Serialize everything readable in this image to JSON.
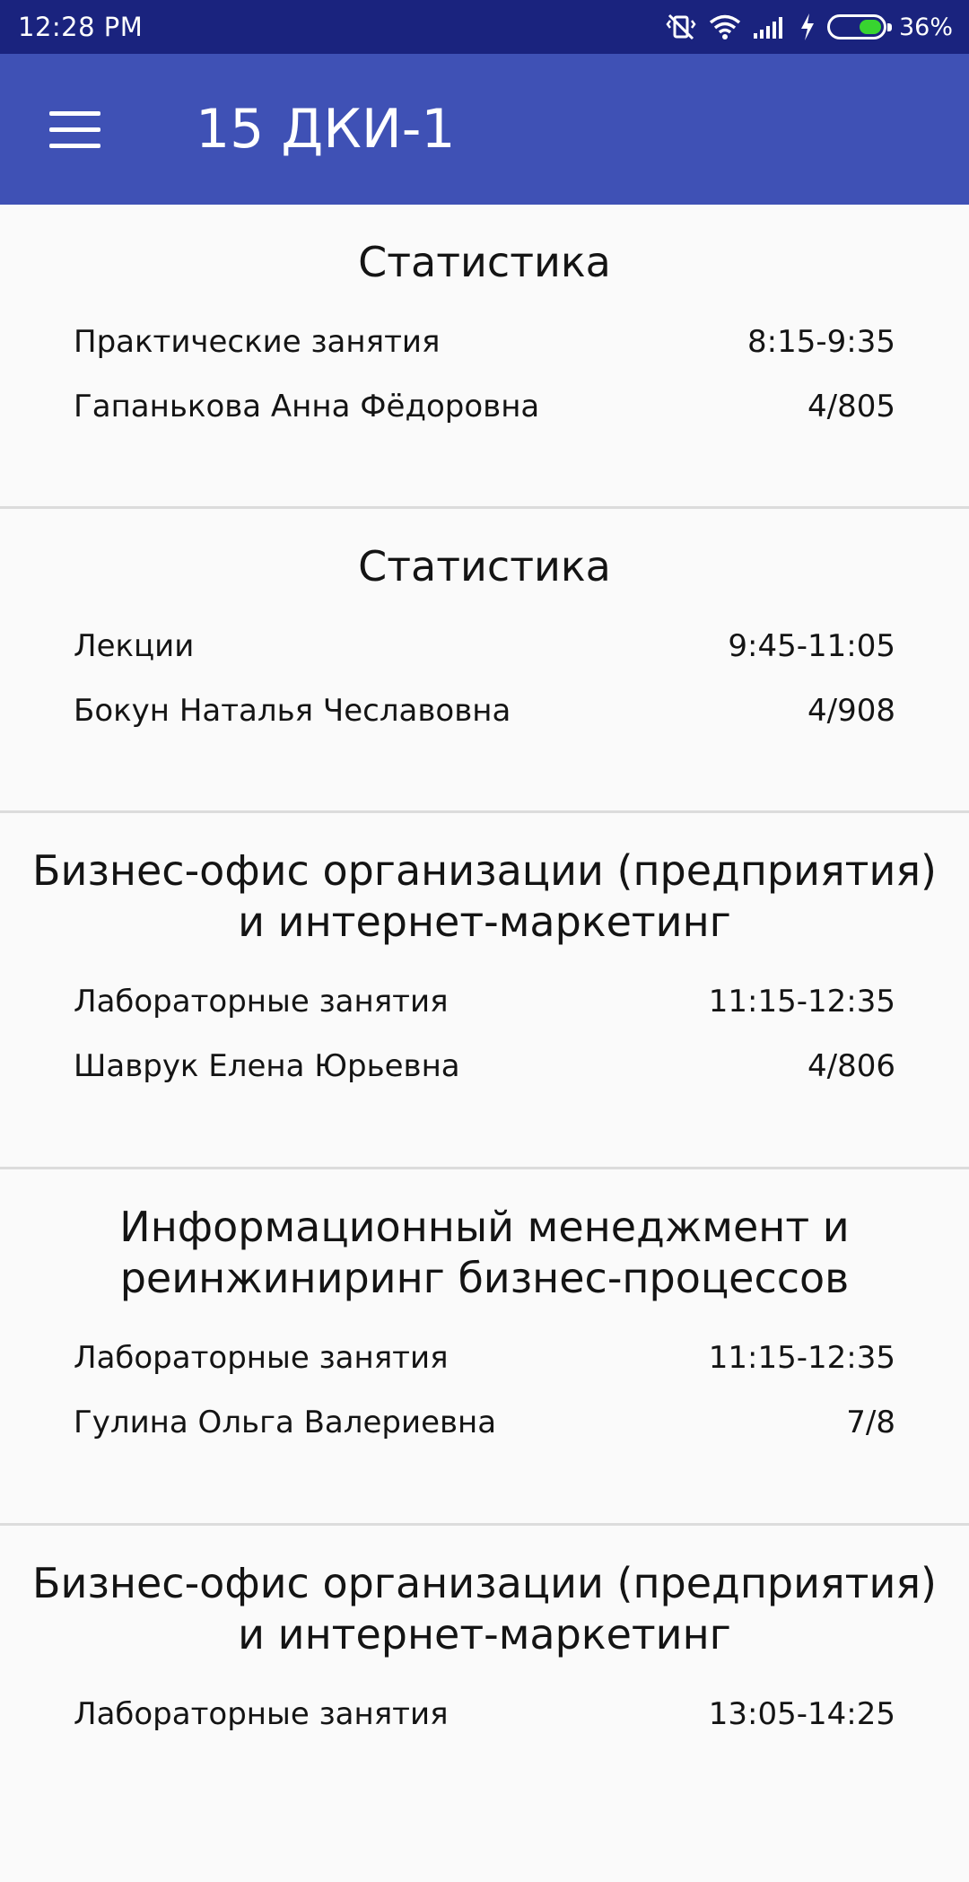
{
  "status_bar": {
    "time": "12:28 PM",
    "battery_percent": "36%",
    "battery_level": 0.36
  },
  "app_bar": {
    "title": "15 ДКИ-1",
    "menu_icon": "hamburger-menu-icon"
  },
  "lessons": [
    {
      "title": "Статистика",
      "type": "Практические занятия",
      "time": "8:15-9:35",
      "teacher": "Гапанькова Анна Фёдоровна",
      "room": "4/805"
    },
    {
      "title": "Статистика",
      "type": "Лекции",
      "time": "9:45-11:05",
      "teacher": "Бокун Наталья Чеславовна",
      "room": "4/908"
    },
    {
      "title": "Бизнес-офис организации (предприятия) и интернет-маркетинг",
      "type": "Лабораторные занятия",
      "time": "11:15-12:35",
      "teacher": "Шаврук Елена Юрьевна",
      "room": "4/806"
    },
    {
      "title": "Информационный менеджмент и реинжиниринг бизнес-процессов",
      "type": "Лабораторные занятия",
      "time": "11:15-12:35",
      "teacher": "Гулина Ольга Валериевна",
      "room": "7/8"
    },
    {
      "title": "Бизнес-офис организации (предприятия) и интернет-маркетинг",
      "type": "Лабораторные занятия",
      "time": "13:05-14:25",
      "teacher": "",
      "room": ""
    }
  ]
}
